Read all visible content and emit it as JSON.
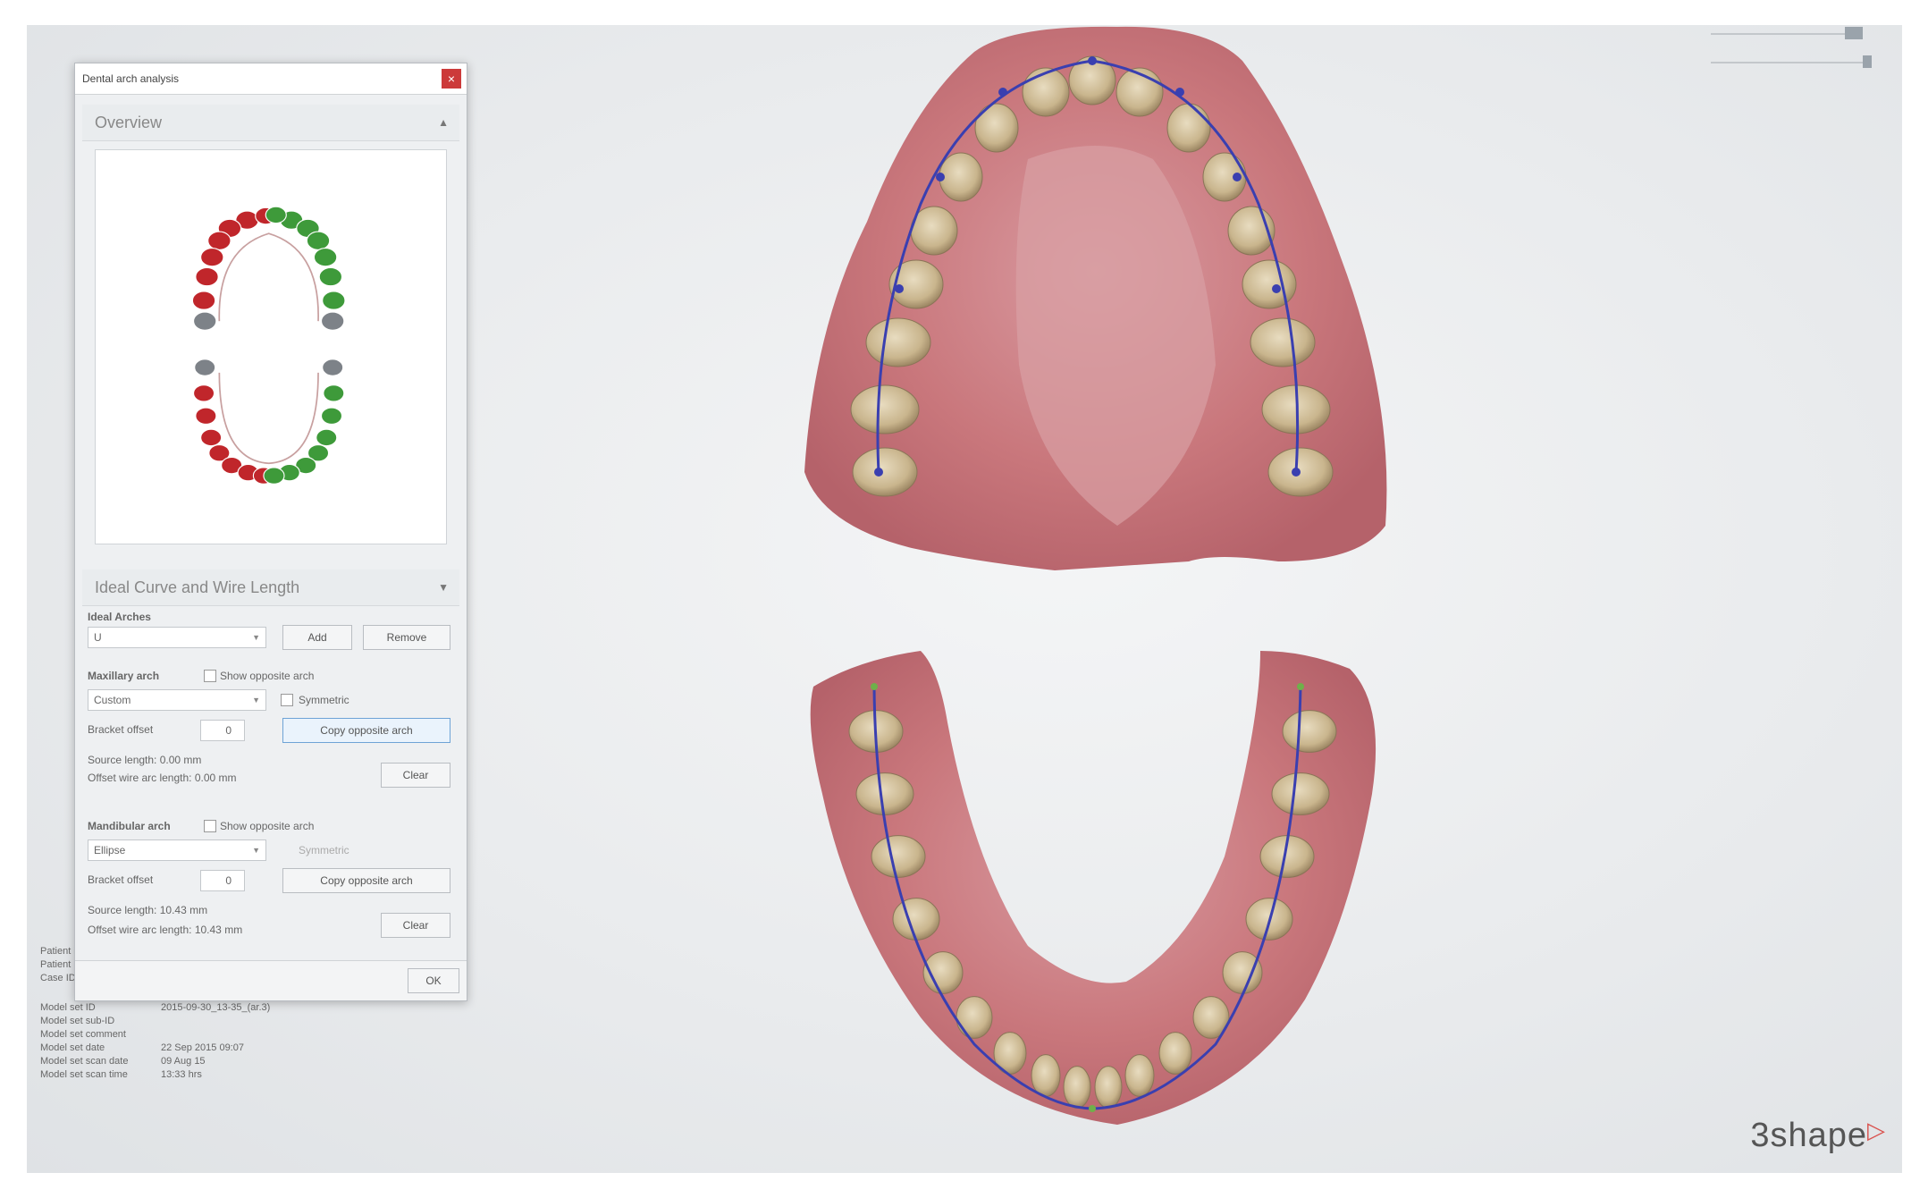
{
  "window": {
    "title": "Dental arch analysis",
    "close_glyph": "×"
  },
  "overview": {
    "header": "Overview"
  },
  "ideal": {
    "header": "Ideal Curve and Wire Length",
    "ideal_arches_label": "Ideal Arches",
    "ideal_arch_value": "U",
    "add_label": "Add",
    "remove_label": "Remove"
  },
  "maxillary": {
    "label": "Maxillary arch",
    "show_opposite": "Show opposite arch",
    "curve_value": "Custom",
    "symmetric_label": "Symmetric",
    "bracket_offset_label": "Bracket offset",
    "bracket_offset_value": "0",
    "copy_opposite": "Copy opposite arch",
    "source_length": "Source length: 0.00 mm",
    "offset_wire_length": "Offset wire arc length: 0.00 mm",
    "clear_label": "Clear"
  },
  "mandibular": {
    "label": "Mandibular arch",
    "show_opposite": "Show opposite arch",
    "curve_value": "Ellipse",
    "symmetric_label": "Symmetric",
    "bracket_offset_label": "Bracket offset",
    "bracket_offset_value": "0",
    "copy_opposite": "Copy opposite arch",
    "source_length": "Source length: 10.43 mm",
    "offset_wire_length": "Offset wire arc length: 10.43 mm",
    "clear_label": "Clear"
  },
  "footer": {
    "ok_label": "OK"
  },
  "info": {
    "rows_top": [
      "Patient info",
      "Patient name",
      "Case ID"
    ],
    "rows": [
      {
        "k": "Model set ID",
        "v": "2015-09-30_13-35_(ar.3)"
      },
      {
        "k": "Model set sub-ID",
        "v": ""
      },
      {
        "k": "Model set comment",
        "v": ""
      },
      {
        "k": "Model set date",
        "v": "22 Sep 2015 09:07"
      },
      {
        "k": "Model set scan date",
        "v": "09 Aug 15"
      },
      {
        "k": "Model set scan time",
        "v": "13:33 hrs"
      }
    ]
  },
  "brand": {
    "name": "3shape",
    "mark": "▷"
  },
  "colors": {
    "arch_curve": "#3a3fb0",
    "red_teeth": "#c0262b",
    "green_teeth": "#3e9a3a",
    "gum": "#c9777c"
  }
}
